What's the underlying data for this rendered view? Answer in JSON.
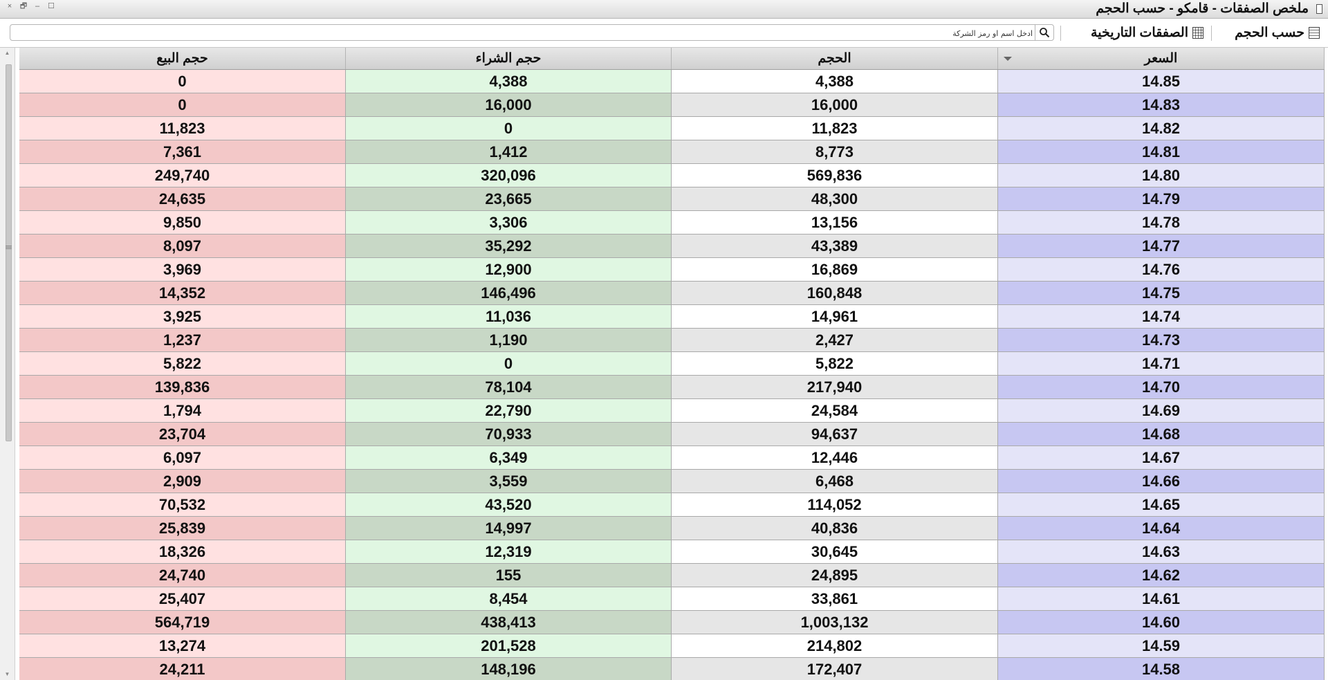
{
  "window": {
    "title": "ملخص الصفقات - قامكو - حسب الحجم",
    "controls": {
      "close": "×",
      "restore": "🗗",
      "minimize": "–",
      "maximize": "☐"
    }
  },
  "toolbar": {
    "by_volume_label": "حسب الحجم",
    "historical_label": "الصفقات التاريخية",
    "search_placeholder": "ادخل اسم او رمز الشركة"
  },
  "table": {
    "headers": {
      "sell_volume": "حجم البيع",
      "buy_volume": "حجم الشراء",
      "volume": "الحجم",
      "price": "السعر"
    },
    "rows": [
      {
        "sell": "0",
        "buy": "4,388",
        "volume": "4,388",
        "price": "14.85"
      },
      {
        "sell": "0",
        "buy": "16,000",
        "volume": "16,000",
        "price": "14.83"
      },
      {
        "sell": "11,823",
        "buy": "0",
        "volume": "11,823",
        "price": "14.82"
      },
      {
        "sell": "7,361",
        "buy": "1,412",
        "volume": "8,773",
        "price": "14.81"
      },
      {
        "sell": "249,740",
        "buy": "320,096",
        "volume": "569,836",
        "price": "14.80"
      },
      {
        "sell": "24,635",
        "buy": "23,665",
        "volume": "48,300",
        "price": "14.79"
      },
      {
        "sell": "9,850",
        "buy": "3,306",
        "volume": "13,156",
        "price": "14.78"
      },
      {
        "sell": "8,097",
        "buy": "35,292",
        "volume": "43,389",
        "price": "14.77"
      },
      {
        "sell": "3,969",
        "buy": "12,900",
        "volume": "16,869",
        "price": "14.76"
      },
      {
        "sell": "14,352",
        "buy": "146,496",
        "volume": "160,848",
        "price": "14.75"
      },
      {
        "sell": "3,925",
        "buy": "11,036",
        "volume": "14,961",
        "price": "14.74"
      },
      {
        "sell": "1,237",
        "buy": "1,190",
        "volume": "2,427",
        "price": "14.73"
      },
      {
        "sell": "5,822",
        "buy": "0",
        "volume": "5,822",
        "price": "14.71"
      },
      {
        "sell": "139,836",
        "buy": "78,104",
        "volume": "217,940",
        "price": "14.70"
      },
      {
        "sell": "1,794",
        "buy": "22,790",
        "volume": "24,584",
        "price": "14.69"
      },
      {
        "sell": "23,704",
        "buy": "70,933",
        "volume": "94,637",
        "price": "14.68"
      },
      {
        "sell": "6,097",
        "buy": "6,349",
        "volume": "12,446",
        "price": "14.67"
      },
      {
        "sell": "2,909",
        "buy": "3,559",
        "volume": "6,468",
        "price": "14.66"
      },
      {
        "sell": "70,532",
        "buy": "43,520",
        "volume": "114,052",
        "price": "14.65"
      },
      {
        "sell": "25,839",
        "buy": "14,997",
        "volume": "40,836",
        "price": "14.64"
      },
      {
        "sell": "18,326",
        "buy": "12,319",
        "volume": "30,645",
        "price": "14.63"
      },
      {
        "sell": "24,740",
        "buy": "155",
        "volume": "24,895",
        "price": "14.62"
      },
      {
        "sell": "25,407",
        "buy": "8,454",
        "volume": "33,861",
        "price": "14.61"
      },
      {
        "sell": "564,719",
        "buy": "438,413",
        "volume": "1,003,132",
        "price": "14.60"
      },
      {
        "sell": "13,274",
        "buy": "201,528",
        "volume": "214,802",
        "price": "14.59"
      },
      {
        "sell": "24,211",
        "buy": "148,196",
        "volume": "172,407",
        "price": "14.58"
      }
    ]
  },
  "colors": {
    "sell_light": "#ffe1e1",
    "sell_dark": "#f3c8c8",
    "buy_light": "#e0f7e2",
    "buy_dark": "#c8d8c6",
    "price_light": "#e4e4f8",
    "price_dark": "#c7c7f2"
  }
}
